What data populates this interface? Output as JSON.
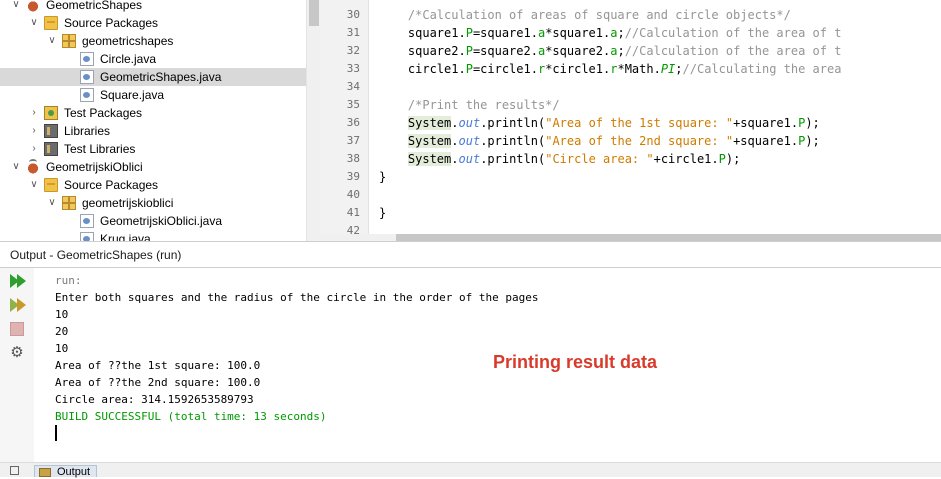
{
  "project_tree": [
    {
      "label": "GeometricShapes",
      "level": 0,
      "icon": "coffee-cup-icon",
      "expanded": true,
      "has_toggle": true,
      "selected": false
    },
    {
      "label": "Source Packages",
      "level": 1,
      "icon": "package-folder-icon",
      "expanded": true,
      "has_toggle": true,
      "selected": false
    },
    {
      "label": "geometricshapes",
      "level": 2,
      "icon": "package-icon",
      "expanded": true,
      "has_toggle": true,
      "selected": false
    },
    {
      "label": "Circle.java",
      "level": 3,
      "icon": "java-file-icon",
      "expanded": false,
      "has_toggle": false,
      "selected": false
    },
    {
      "label": "GeometricShapes.java",
      "level": 3,
      "icon": "java-file-icon",
      "expanded": false,
      "has_toggle": false,
      "selected": true
    },
    {
      "label": "Square.java",
      "level": 3,
      "icon": "java-file-icon",
      "expanded": false,
      "has_toggle": false,
      "selected": false
    },
    {
      "label": "Test Packages",
      "level": 1,
      "icon": "test-package-icon",
      "expanded": false,
      "has_toggle": true,
      "selected": false
    },
    {
      "label": "Libraries",
      "level": 1,
      "icon": "libraries-icon",
      "expanded": false,
      "has_toggle": true,
      "selected": false
    },
    {
      "label": "Test Libraries",
      "level": 1,
      "icon": "libraries-icon",
      "expanded": false,
      "has_toggle": true,
      "selected": false
    },
    {
      "label": "GeometrijskiOblici",
      "level": 0,
      "icon": "coffee-cup-icon",
      "expanded": true,
      "has_toggle": true,
      "selected": false
    },
    {
      "label": "Source Packages",
      "level": 1,
      "icon": "package-folder-icon",
      "expanded": true,
      "has_toggle": true,
      "selected": false
    },
    {
      "label": "geometrijskioblici",
      "level": 2,
      "icon": "package-icon",
      "expanded": true,
      "has_toggle": true,
      "selected": false
    },
    {
      "label": "GeometrijskiOblici.java",
      "level": 3,
      "icon": "java-file-icon",
      "expanded": false,
      "has_toggle": false,
      "selected": false
    },
    {
      "label": "Krug.java",
      "level": 3,
      "icon": "java-file-icon",
      "expanded": false,
      "has_toggle": false,
      "selected": false
    }
  ],
  "editor": {
    "lines": [
      {
        "num": "30",
        "text": "    /*Calculation of areas of square and circle objects*/"
      },
      {
        "num": "31",
        "text": "    square1.P=square1.a*square1.a;//Calculation of the area of t"
      },
      {
        "num": "32",
        "text": "    square2.P=square2.a*square2.a;//Calculation of the area of t"
      },
      {
        "num": "33",
        "text": "    circle1.P=circle1.r*circle1.r*Math.PI;//Calculating the area"
      },
      {
        "num": "34",
        "text": ""
      },
      {
        "num": "35",
        "text": "    /*Print the results*/"
      },
      {
        "num": "36",
        "text": "    System.out.println(\"Area of the 1st square: \"+square1.P);"
      },
      {
        "num": "37",
        "text": "    System.out.println(\"Area of the 2nd square: \"+square1.P);"
      },
      {
        "num": "38",
        "text": "    System.out.println(\"Circle area: \"+circle1.P);"
      },
      {
        "num": "39",
        "text": "}"
      },
      {
        "num": "40",
        "text": ""
      },
      {
        "num": "41",
        "text": "}"
      },
      {
        "num": "42",
        "text": ""
      }
    ]
  },
  "output": {
    "title": "Output - GeometricShapes (run)",
    "lines": [
      {
        "text": "run:",
        "kind": "run"
      },
      {
        "text": "Enter both squares and the radius of the circle in the order of the pages",
        "kind": "normal"
      },
      {
        "text": "10",
        "kind": "normal"
      },
      {
        "text": "20",
        "kind": "normal"
      },
      {
        "text": "10",
        "kind": "normal"
      },
      {
        "text": "Area of ??the 1st square: 100.0",
        "kind": "normal"
      },
      {
        "text": "Area of ??the 2nd square: 100.0",
        "kind": "normal"
      },
      {
        "text": "Circle area: 314.1592653589793",
        "kind": "normal"
      },
      {
        "text": "BUILD SUCCESSFUL (total time: 13 seconds)",
        "kind": "build"
      }
    ],
    "toolbar": [
      "rerun-icon",
      "rerun-with-args-icon",
      "stop-icon",
      "settings-icon"
    ],
    "annotation": "Printing result data"
  },
  "bottom_tab": {
    "label": "Output"
  },
  "colors": {
    "comment": "#959595",
    "string": "#ce7b00",
    "field": "#009900",
    "system_highlight": "#e4edd9",
    "annotation": "#d83a2b",
    "build_success": "#009900"
  }
}
